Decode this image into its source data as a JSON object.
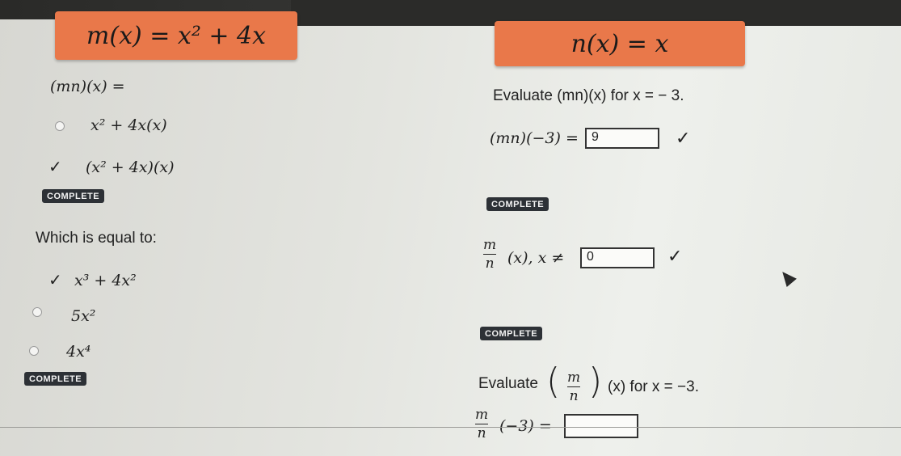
{
  "functions": {
    "m": "m(x) = x² + 4x",
    "n": "n(x) = x"
  },
  "left": {
    "q1": {
      "prompt": "(mn)(x) =",
      "options": [
        "x² + 4x(x)",
        "(x² + 4x)(x)"
      ],
      "selected_index": 1,
      "status": "COMPLETE"
    },
    "q2": {
      "prompt": "Which is equal to:",
      "options": [
        "x³ + 4x²",
        "5x²",
        "4x⁴"
      ],
      "selected_index": 0,
      "status": "COMPLETE"
    }
  },
  "right": {
    "q1": {
      "prompt": "Evaluate (mn)(x) for x = − 3.",
      "expr": "(mn)(−3) =",
      "answer": "9",
      "status": "COMPLETE"
    },
    "q2": {
      "frac_num": "m",
      "frac_den": "n",
      "expr_tail": "(x),  x ≠",
      "answer": "0",
      "status": "COMPLETE"
    },
    "q3": {
      "prompt_word": "Evaluate",
      "frac_num": "m",
      "frac_den": "n",
      "tail": "(x) for x = −3.",
      "expr_tail": "(−3) =",
      "answer": ""
    }
  },
  "icons": {
    "check": "✓"
  }
}
